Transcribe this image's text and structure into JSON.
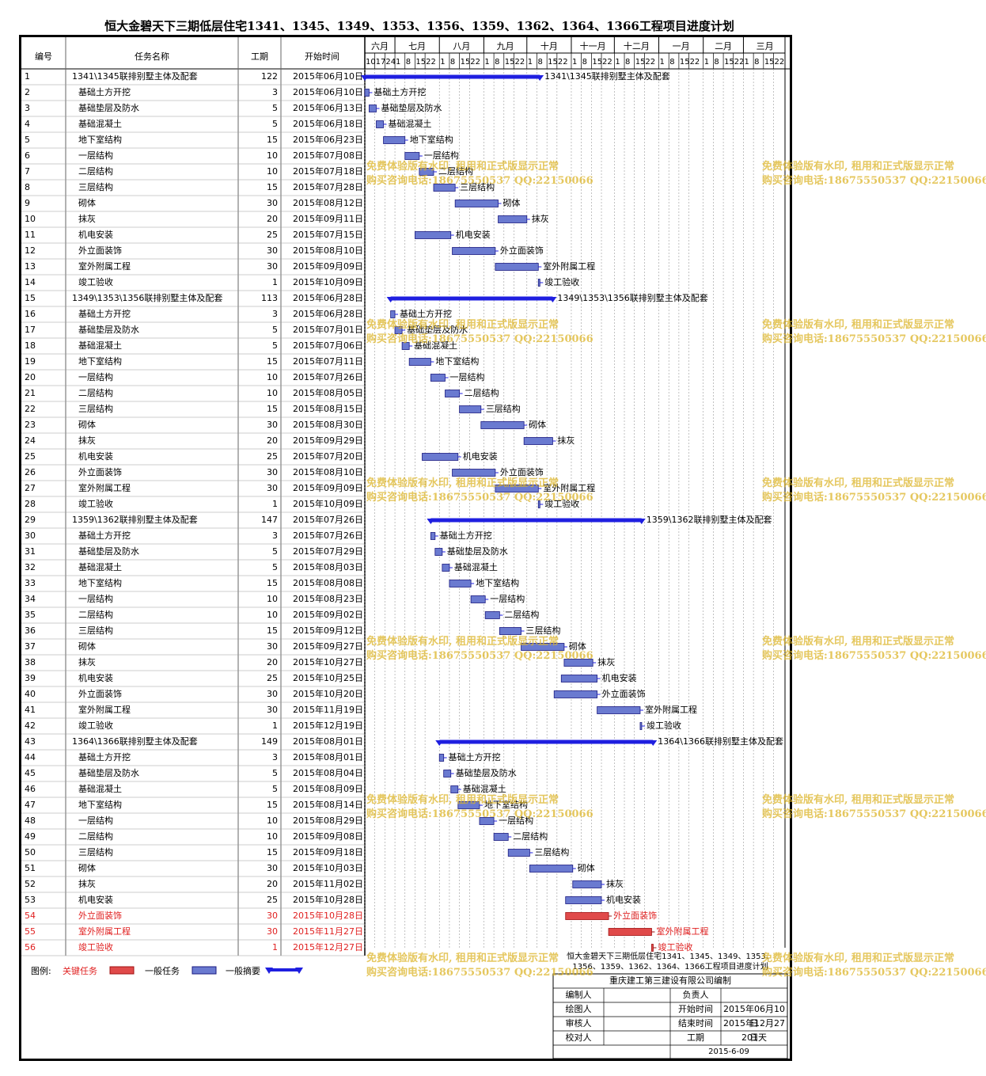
{
  "title": "恒大金碧天下三期低层住宅1341、1345、1349、1353、1356、1359、1362、1364、1366工程项目进度计划",
  "columns": {
    "id": "编号",
    "name": "任务名称",
    "duration": "工期",
    "start": "开始时间"
  },
  "months": [
    "六月",
    "七月",
    "八月",
    "九月",
    "十月",
    "十一月",
    "十二月",
    "一月",
    "二月",
    "三月"
  ],
  "days": [
    "10",
    "17",
    "24",
    "1",
    "8",
    "15",
    "22",
    "1",
    "8",
    "15",
    "22",
    "1",
    "8",
    "15",
    "22",
    "1",
    "8",
    "15",
    "22",
    "1",
    "8",
    "15",
    "22",
    "1",
    "8",
    "15",
    "22",
    "1",
    "8",
    "15",
    "22",
    "1",
    "8",
    "15",
    "22",
    "1",
    "8",
    "15",
    "22"
  ],
  "tasks": [
    {
      "id": "1",
      "name": "1341\\1345联排别墅主体及配套",
      "dur": "122",
      "start": "2015年06月10日",
      "sd": 0,
      "dd": 122,
      "type": "summary",
      "label": "1341\\1345联排别墅主体及配套"
    },
    {
      "id": "2",
      "name": "基础土方开挖",
      "dur": "3",
      "start": "2015年06月10日",
      "sd": 0,
      "dd": 3,
      "type": "normal",
      "label": "基础土方开挖"
    },
    {
      "id": "3",
      "name": "基础垫层及防水",
      "dur": "5",
      "start": "2015年06月13日",
      "sd": 3,
      "dd": 5,
      "type": "normal",
      "label": "基础垫层及防水"
    },
    {
      "id": "4",
      "name": "基础混凝土",
      "dur": "5",
      "start": "2015年06月18日",
      "sd": 8,
      "dd": 5,
      "type": "normal",
      "label": "基础混凝土"
    },
    {
      "id": "5",
      "name": "地下室结构",
      "dur": "15",
      "start": "2015年06月23日",
      "sd": 13,
      "dd": 15,
      "type": "normal",
      "label": "地下室结构"
    },
    {
      "id": "6",
      "name": "一层结构",
      "dur": "10",
      "start": "2015年07月08日",
      "sd": 28,
      "dd": 10,
      "type": "normal",
      "label": "一层结构"
    },
    {
      "id": "7",
      "name": "二层结构",
      "dur": "10",
      "start": "2015年07月18日",
      "sd": 38,
      "dd": 10,
      "type": "normal",
      "label": "二层结构"
    },
    {
      "id": "8",
      "name": "三层结构",
      "dur": "15",
      "start": "2015年07月28日",
      "sd": 48,
      "dd": 15,
      "type": "normal",
      "label": "三层结构"
    },
    {
      "id": "9",
      "name": "砌体",
      "dur": "30",
      "start": "2015年08月12日",
      "sd": 63,
      "dd": 30,
      "type": "normal",
      "label": "砌体"
    },
    {
      "id": "10",
      "name": "抹灰",
      "dur": "20",
      "start": "2015年09月11日",
      "sd": 93,
      "dd": 20,
      "type": "normal",
      "label": "抹灰"
    },
    {
      "id": "11",
      "name": "机电安装",
      "dur": "25",
      "start": "2015年07月15日",
      "sd": 35,
      "dd": 25,
      "type": "normal",
      "label": "机电安装"
    },
    {
      "id": "12",
      "name": "外立面装饰",
      "dur": "30",
      "start": "2015年08月10日",
      "sd": 61,
      "dd": 30,
      "type": "normal",
      "label": "外立面装饰"
    },
    {
      "id": "13",
      "name": "室外附属工程",
      "dur": "30",
      "start": "2015年09月09日",
      "sd": 91,
      "dd": 30,
      "type": "normal",
      "label": "室外附属工程"
    },
    {
      "id": "14",
      "name": "竣工验收",
      "dur": "1",
      "start": "2015年10月09日",
      "sd": 121,
      "dd": 1,
      "type": "normal",
      "label": "竣工验收"
    },
    {
      "id": "15",
      "name": "1349\\1353\\1356联排别墅主体及配套",
      "dur": "113",
      "start": "2015年06月28日",
      "sd": 18,
      "dd": 113,
      "type": "summary",
      "label": "1349\\1353\\1356联排别墅主体及配套"
    },
    {
      "id": "16",
      "name": "基础土方开挖",
      "dur": "3",
      "start": "2015年06月28日",
      "sd": 18,
      "dd": 3,
      "type": "normal",
      "label": "基础土方开挖"
    },
    {
      "id": "17",
      "name": "基础垫层及防水",
      "dur": "5",
      "start": "2015年07月01日",
      "sd": 21,
      "dd": 5,
      "type": "normal",
      "label": "基础垫层及防水"
    },
    {
      "id": "18",
      "name": "基础混凝土",
      "dur": "5",
      "start": "2015年07月06日",
      "sd": 26,
      "dd": 5,
      "type": "normal",
      "label": "基础混凝土"
    },
    {
      "id": "19",
      "name": "地下室结构",
      "dur": "15",
      "start": "2015年07月11日",
      "sd": 31,
      "dd": 15,
      "type": "normal",
      "label": "地下室结构"
    },
    {
      "id": "20",
      "name": "一层结构",
      "dur": "10",
      "start": "2015年07月26日",
      "sd": 46,
      "dd": 10,
      "type": "normal",
      "label": "一层结构"
    },
    {
      "id": "21",
      "name": "二层结构",
      "dur": "10",
      "start": "2015年08月05日",
      "sd": 56,
      "dd": 10,
      "type": "normal",
      "label": "二层结构"
    },
    {
      "id": "22",
      "name": "三层结构",
      "dur": "15",
      "start": "2015年08月15日",
      "sd": 66,
      "dd": 15,
      "type": "normal",
      "label": "三层结构"
    },
    {
      "id": "23",
      "name": "砌体",
      "dur": "30",
      "start": "2015年08月30日",
      "sd": 81,
      "dd": 30,
      "type": "normal",
      "label": "砌体"
    },
    {
      "id": "24",
      "name": "抹灰",
      "dur": "20",
      "start": "2015年09月29日",
      "sd": 111,
      "dd": 20,
      "type": "normal",
      "label": "抹灰"
    },
    {
      "id": "25",
      "name": "机电安装",
      "dur": "25",
      "start": "2015年07月20日",
      "sd": 40,
      "dd": 25,
      "type": "normal",
      "label": "机电安装"
    },
    {
      "id": "26",
      "name": "外立面装饰",
      "dur": "30",
      "start": "2015年08月10日",
      "sd": 61,
      "dd": 30,
      "type": "normal",
      "label": "外立面装饰"
    },
    {
      "id": "27",
      "name": "室外附属工程",
      "dur": "30",
      "start": "2015年09月09日",
      "sd": 91,
      "dd": 30,
      "type": "normal",
      "label": "室外附属工程"
    },
    {
      "id": "28",
      "name": "竣工验收",
      "dur": "1",
      "start": "2015年10月09日",
      "sd": 121,
      "dd": 1,
      "type": "normal",
      "label": "竣工验收"
    },
    {
      "id": "29",
      "name": "1359\\1362联排别墅主体及配套",
      "dur": "147",
      "start": "2015年07月26日",
      "sd": 46,
      "dd": 147,
      "type": "summary",
      "label": "1359\\1362联排别墅主体及配套"
    },
    {
      "id": "30",
      "name": "基础土方开挖",
      "dur": "3",
      "start": "2015年07月26日",
      "sd": 46,
      "dd": 3,
      "type": "normal",
      "label": "基础土方开挖"
    },
    {
      "id": "31",
      "name": "基础垫层及防水",
      "dur": "5",
      "start": "2015年07月29日",
      "sd": 49,
      "dd": 5,
      "type": "normal",
      "label": "基础垫层及防水"
    },
    {
      "id": "32",
      "name": "基础混凝土",
      "dur": "5",
      "start": "2015年08月03日",
      "sd": 54,
      "dd": 5,
      "type": "normal",
      "label": "基础混凝土"
    },
    {
      "id": "33",
      "name": "地下室结构",
      "dur": "15",
      "start": "2015年08月08日",
      "sd": 59,
      "dd": 15,
      "type": "normal",
      "label": "地下室结构"
    },
    {
      "id": "34",
      "name": "一层结构",
      "dur": "10",
      "start": "2015年08月23日",
      "sd": 74,
      "dd": 10,
      "type": "normal",
      "label": "一层结构"
    },
    {
      "id": "35",
      "name": "二层结构",
      "dur": "10",
      "start": "2015年09月02日",
      "sd": 84,
      "dd": 10,
      "type": "normal",
      "label": "二层结构"
    },
    {
      "id": "36",
      "name": "三层结构",
      "dur": "15",
      "start": "2015年09月12日",
      "sd": 94,
      "dd": 15,
      "type": "normal",
      "label": "三层结构"
    },
    {
      "id": "37",
      "name": "砌体",
      "dur": "30",
      "start": "2015年09月27日",
      "sd": 109,
      "dd": 30,
      "type": "normal",
      "label": "砌体"
    },
    {
      "id": "38",
      "name": "抹灰",
      "dur": "20",
      "start": "2015年10月27日",
      "sd": 139,
      "dd": 20,
      "type": "normal",
      "label": "抹灰"
    },
    {
      "id": "39",
      "name": "机电安装",
      "dur": "25",
      "start": "2015年10月25日",
      "sd": 137,
      "dd": 25,
      "type": "normal",
      "label": "机电安装"
    },
    {
      "id": "40",
      "name": "外立面装饰",
      "dur": "30",
      "start": "2015年10月20日",
      "sd": 132,
      "dd": 30,
      "type": "normal",
      "label": "外立面装饰"
    },
    {
      "id": "41",
      "name": "室外附属工程",
      "dur": "30",
      "start": "2015年11月19日",
      "sd": 162,
      "dd": 30,
      "type": "normal",
      "label": "室外附属工程"
    },
    {
      "id": "42",
      "name": "竣工验收",
      "dur": "1",
      "start": "2015年12月19日",
      "sd": 192,
      "dd": 1,
      "type": "normal",
      "label": "竣工验收"
    },
    {
      "id": "43",
      "name": "1364\\1366联排别墅主体及配套",
      "dur": "149",
      "start": "2015年08月01日",
      "sd": 52,
      "dd": 149,
      "type": "summary",
      "label": "1364\\1366联排别墅主体及配套"
    },
    {
      "id": "44",
      "name": "基础土方开挖",
      "dur": "3",
      "start": "2015年08月01日",
      "sd": 52,
      "dd": 3,
      "type": "normal",
      "label": "基础土方开挖"
    },
    {
      "id": "45",
      "name": "基础垫层及防水",
      "dur": "5",
      "start": "2015年08月04日",
      "sd": 55,
      "dd": 5,
      "type": "normal",
      "label": "基础垫层及防水"
    },
    {
      "id": "46",
      "name": "基础混凝土",
      "dur": "5",
      "start": "2015年08月09日",
      "sd": 60,
      "dd": 5,
      "type": "normal",
      "label": "基础混凝土"
    },
    {
      "id": "47",
      "name": "地下室结构",
      "dur": "15",
      "start": "2015年08月14日",
      "sd": 65,
      "dd": 15,
      "type": "normal",
      "label": "地下室结构"
    },
    {
      "id": "48",
      "name": "一层结构",
      "dur": "10",
      "start": "2015年08月29日",
      "sd": 80,
      "dd": 10,
      "type": "normal",
      "label": "一层结构"
    },
    {
      "id": "49",
      "name": "二层结构",
      "dur": "10",
      "start": "2015年09月08日",
      "sd": 90,
      "dd": 10,
      "type": "normal",
      "label": "二层结构"
    },
    {
      "id": "50",
      "name": "三层结构",
      "dur": "15",
      "start": "2015年09月18日",
      "sd": 100,
      "dd": 15,
      "type": "normal",
      "label": "三层结构"
    },
    {
      "id": "51",
      "name": "砌体",
      "dur": "30",
      "start": "2015年10月03日",
      "sd": 115,
      "dd": 30,
      "type": "normal",
      "label": "砌体"
    },
    {
      "id": "52",
      "name": "抹灰",
      "dur": "20",
      "start": "2015年11月02日",
      "sd": 145,
      "dd": 20,
      "type": "normal",
      "label": "抹灰"
    },
    {
      "id": "53",
      "name": "机电安装",
      "dur": "25",
      "start": "2015年10月28日",
      "sd": 140,
      "dd": 25,
      "type": "normal",
      "label": "机电安装"
    },
    {
      "id": "54",
      "name": "外立面装饰",
      "dur": "30",
      "start": "2015年10月28日",
      "sd": 140,
      "dd": 30,
      "type": "critical",
      "label": "外立面装饰"
    },
    {
      "id": "55",
      "name": "室外附属工程",
      "dur": "30",
      "start": "2015年11月27日",
      "sd": 170,
      "dd": 30,
      "type": "critical",
      "label": "室外附属工程"
    },
    {
      "id": "56",
      "name": "竣工验收",
      "dur": "1",
      "start": "2015年12月27日",
      "sd": 200,
      "dd": 1,
      "type": "critical",
      "label": "竣工验收"
    }
  ],
  "legend": {
    "title": "图例:",
    "critical": "关键任务",
    "normal": "一般任务",
    "summary": "一般摘要"
  },
  "watermark": {
    "line1": "免费体验版有水印, 租用和正式版显示正常",
    "line2": "购买咨询电话:18675550537 QQ:22150066"
  },
  "title_block": {
    "project": "恒大金碧天下三期低层住宅1341、1345、1349、1353、1356、1359、1362、1364、1366工程项目进度计划",
    "company": "重庆建工第三建设有限公司编制",
    "rows": [
      {
        "l": "编制人",
        "lv": "",
        "r": "负责人",
        "rv": ""
      },
      {
        "l": "绘图人",
        "lv": "",
        "r": "开始时间",
        "rv": "2015年06月10日"
      },
      {
        "l": "审核人",
        "lv": "",
        "r": "结束时间",
        "rv": "2015年12月27日"
      },
      {
        "l": "校对人",
        "lv": "",
        "r": "工期",
        "rv": "201天"
      }
    ],
    "date": "2015-6-09"
  },
  "colors": {
    "summary": "#1f1fe0",
    "normal_fill": "#6a7ad0",
    "normal_edge": "#1a1a80",
    "critical_fill": "#e04a4a",
    "critical_edge": "#a01010",
    "critical_text": "#e02020",
    "arrow": "#1f1fe0",
    "grid": "#999999"
  }
}
